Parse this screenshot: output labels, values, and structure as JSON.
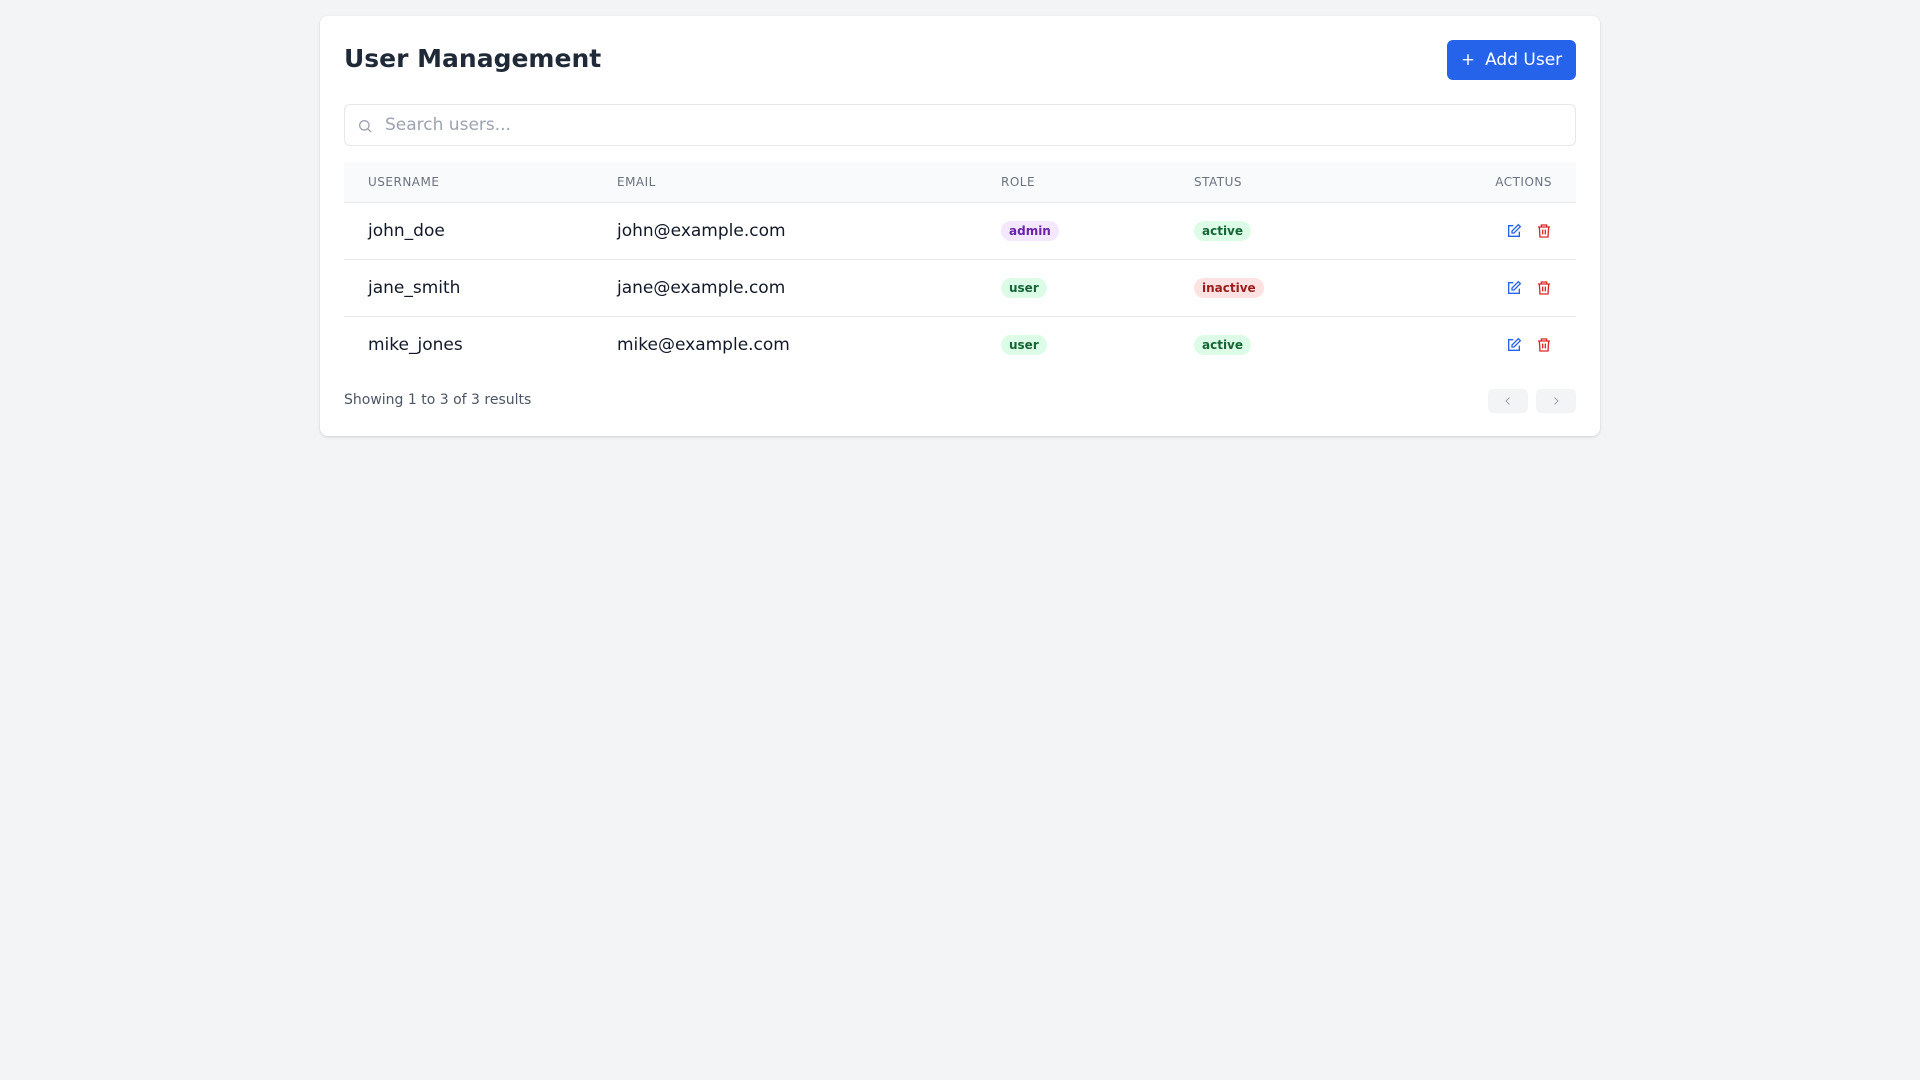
{
  "header": {
    "title": "User Management",
    "add_button": "Add User"
  },
  "search": {
    "placeholder": "Search users...",
    "value": ""
  },
  "table": {
    "columns": [
      "USERNAME",
      "EMAIL",
      "ROLE",
      "STATUS",
      "ACTIONS"
    ],
    "rows": [
      {
        "username": "john_doe",
        "email": "john@example.com",
        "role": "admin",
        "status": "active"
      },
      {
        "username": "jane_smith",
        "email": "jane@example.com",
        "role": "user",
        "status": "inactive"
      },
      {
        "username": "mike_jones",
        "email": "mike@example.com",
        "role": "user",
        "status": "active"
      }
    ]
  },
  "footer": {
    "summary": "Showing 1 to 3 of 3 results"
  },
  "colors": {
    "primary": "#2563eb",
    "danger": "#dc2626"
  }
}
